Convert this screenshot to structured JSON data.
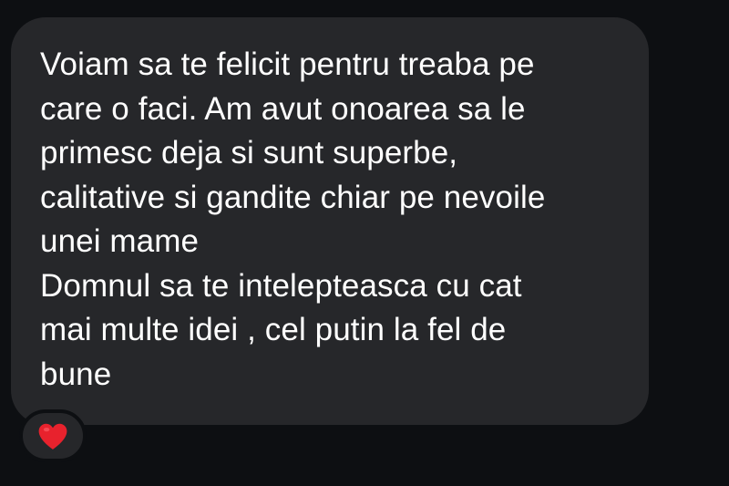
{
  "message": {
    "paragraphs": [
      "Voiam sa te felicit pentru treaba pe\ncare o faci. Am avut onoarea sa le\nprimesc deja si sunt superbe,\ncalitative si gandite chiar pe nevoile\nunei mame",
      "Domnul sa te intelepteasca cu cat\nmai multe idei , cel putin la fel de\nbune"
    ]
  },
  "reaction": {
    "icon": "heart-icon",
    "color": "#e8222d"
  },
  "colors": {
    "background": "#0d0f12",
    "bubble": "#26272a",
    "text": "#ffffff"
  }
}
